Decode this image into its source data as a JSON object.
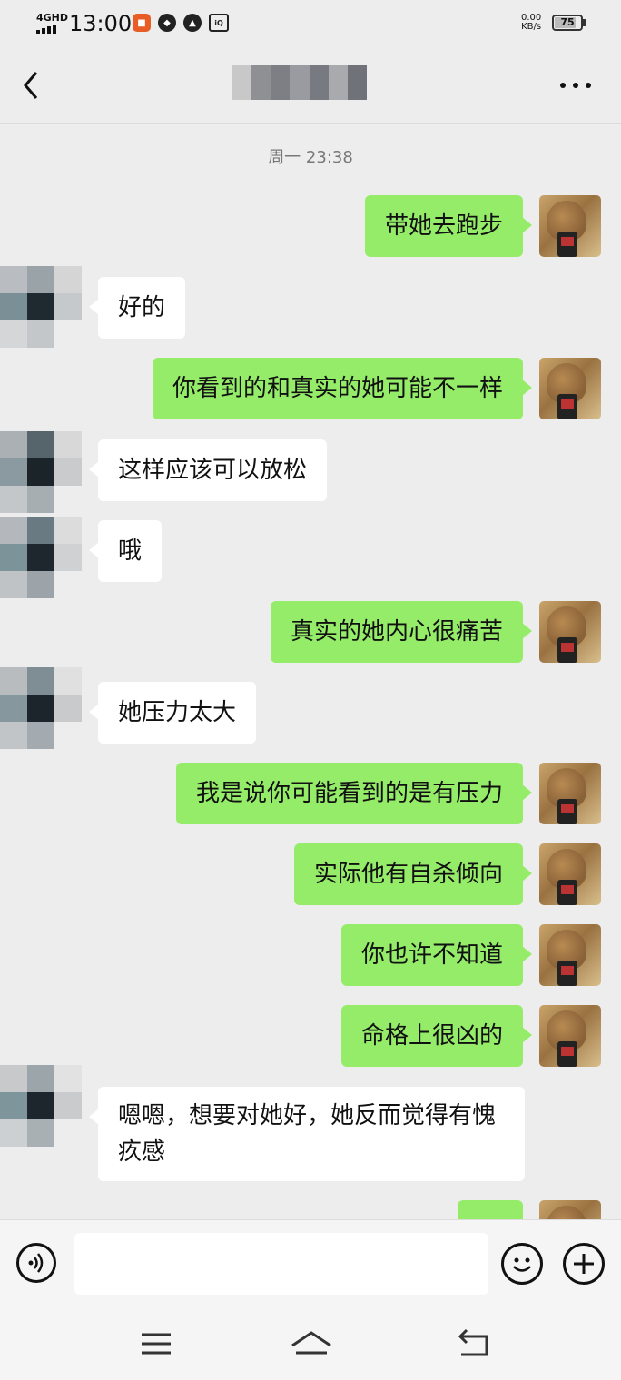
{
  "status_bar": {
    "network": "4GHD",
    "time": "13:00",
    "speed_value": "0.00",
    "speed_unit": "KB/s",
    "battery": "75",
    "battery_level": 0.75
  },
  "header": {
    "back_icon": "chevron-left-icon",
    "more_icon": "more-dots-icon"
  },
  "chat": {
    "timestamp": "周一 23:38",
    "messages": [
      {
        "from": "me",
        "text": "带她去跑步"
      },
      {
        "from": "them",
        "text": "好的"
      },
      {
        "from": "me",
        "text": "你看到的和真实的她可能不一样"
      },
      {
        "from": "them",
        "text": "这样应该可以放松"
      },
      {
        "from": "them",
        "text": "哦"
      },
      {
        "from": "me",
        "text": "真实的她内心很痛苦"
      },
      {
        "from": "them",
        "text": "她压力太大"
      },
      {
        "from": "me",
        "text": "我是说你可能看到的是有压力"
      },
      {
        "from": "me",
        "text": "实际他有自杀倾向"
      },
      {
        "from": "me",
        "text": "你也许不知道"
      },
      {
        "from": "me",
        "text": "命格上很凶的"
      },
      {
        "from": "them",
        "text": "嗯嗯，想要对她好，她反而觉得有愧疚感"
      },
      {
        "from": "me",
        "text": ""
      }
    ]
  },
  "colors": {
    "bubble_me": "#95ec69",
    "bubble_them": "#ffffff",
    "background": "#ededed"
  },
  "input_bar": {
    "voice_icon": "voice-icon",
    "emoji_icon": "emoji-icon",
    "plus_icon": "plus-icon",
    "value": ""
  },
  "nav_bar": {
    "menu_icon": "menu-icon",
    "home_icon": "home-icon",
    "back_icon": "nav-back-icon"
  }
}
